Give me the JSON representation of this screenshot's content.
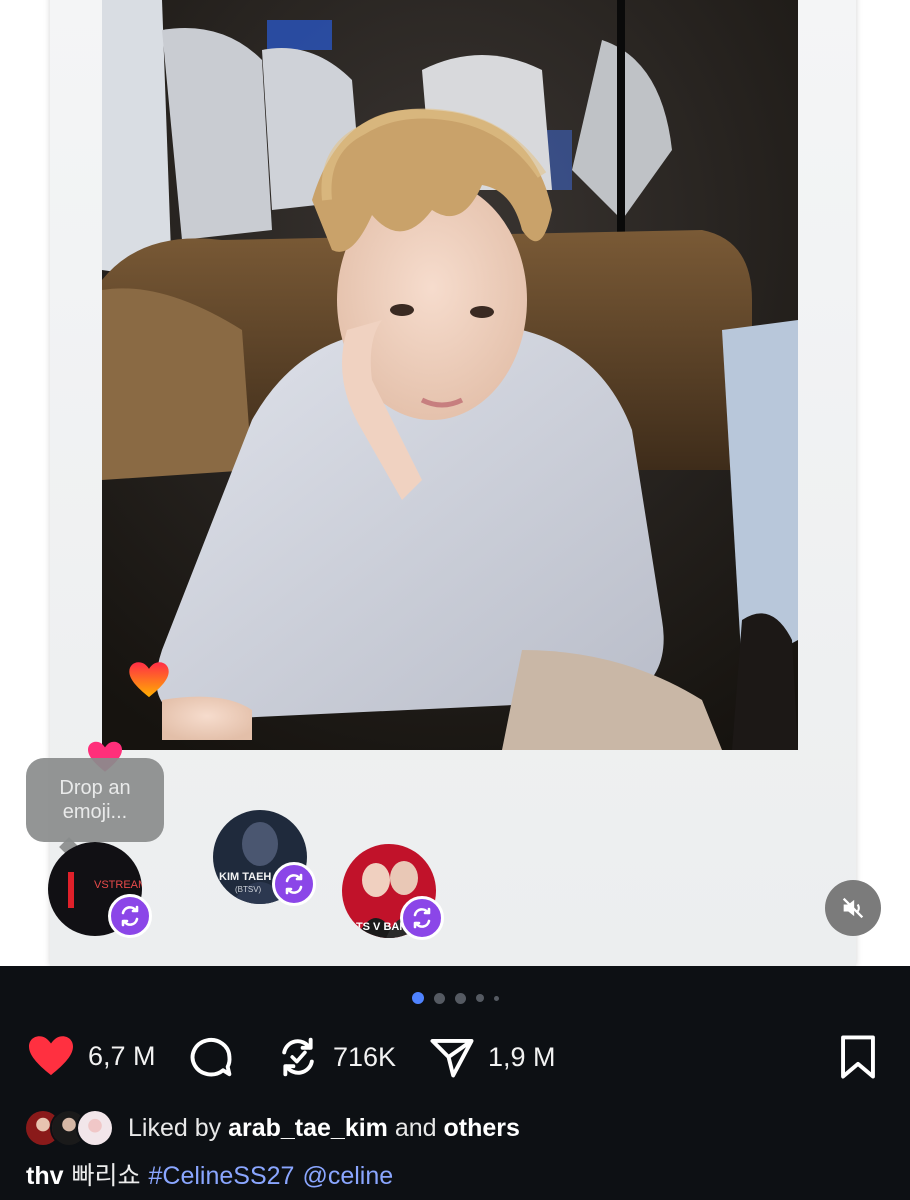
{
  "tooltip": {
    "line1": "Drop an",
    "line2": "emoji..."
  },
  "avatars": {
    "vstream_text": "VSTREAM",
    "kim_text": "KIM TAEH",
    "kim_sub": "(BTSV)",
    "bts_text": "BTS V BANG"
  },
  "dots": {
    "count": 5,
    "active_index": 0
  },
  "actions": {
    "likes": "6,7 M",
    "reposts": "716K",
    "shares": "1,9 M"
  },
  "liked_by": {
    "prefix": "Liked by",
    "user": "arab_tae_kim",
    "joiner": "and",
    "others": "others"
  },
  "caption": {
    "username": "thv",
    "text": "빠리쇼",
    "hashtag": "#CelineSS27",
    "mention": "@celine"
  },
  "colors": {
    "like_red": "#ff3040",
    "repost_purple": "#8b46e8",
    "link_blue": "#8aa6ff",
    "bar_bg": "#0d1014"
  },
  "icons": [
    "heart-icon",
    "comment-icon",
    "repost-icon",
    "share-icon",
    "bookmark-icon",
    "mute-icon"
  ]
}
